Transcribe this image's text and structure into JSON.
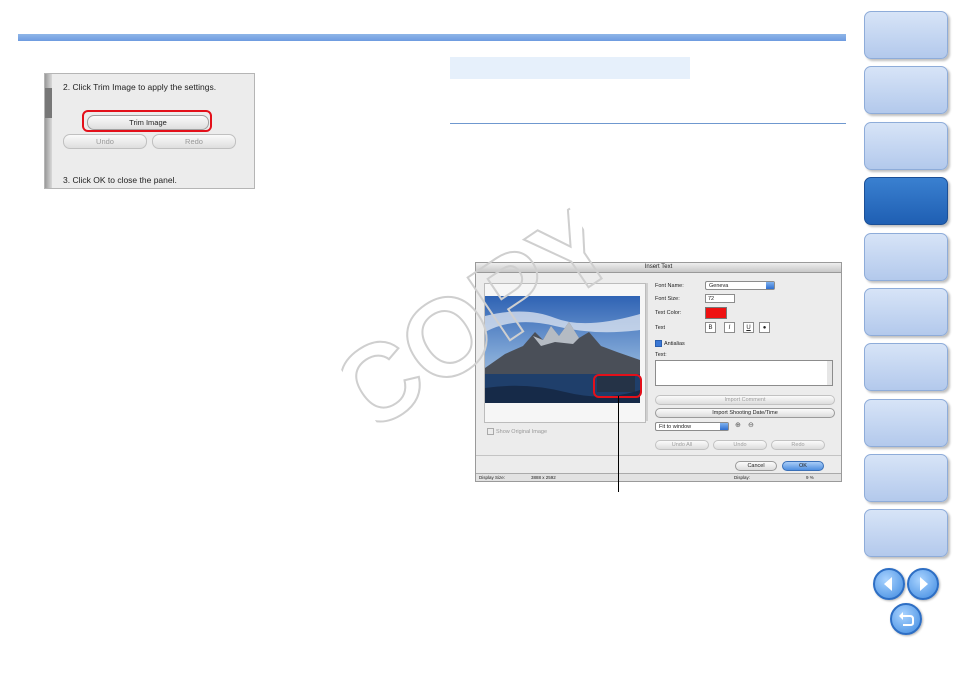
{
  "trim_panel": {
    "step2": "2. Click Trim Image to apply the settings.",
    "trim_button": "Trim Image",
    "undo_button": "Undo",
    "redo_button": "Redo",
    "step3": "3. Click OK to close the panel."
  },
  "dialog": {
    "title": "Insert Text",
    "font_name_label": "Font Name:",
    "font_name_value": "Geneva",
    "font_size_label": "Font Size:",
    "font_size_value": "72",
    "text_color_label": "Text Color:",
    "text_color_value": "#ee1111",
    "text_style_label": "Text",
    "style_buttons": [
      "B",
      "I",
      "U",
      "●"
    ],
    "antialias_label": "Antialias",
    "text_label": "Text:",
    "import_comment_button": "Import Comment",
    "import_date_button": "Import Shooting Date/Time",
    "zoom_select": "Fit to window",
    "undo_all_button": "Undo All",
    "undo_button": "Undo",
    "redo_button": "Redo",
    "cancel_button": "Cancel",
    "ok_button": "OK",
    "show_original_label": "Show Original Image",
    "status_display_size_label": "Display Size:",
    "status_display_size_value": "3888 x 2592",
    "status_display_label": "Display:",
    "status_display_value": "9 %"
  },
  "watermark": "COPY",
  "colors": {
    "accent": "#6e9be0",
    "highlight": "#e3101a",
    "nav_active": "#1f5fb3"
  }
}
